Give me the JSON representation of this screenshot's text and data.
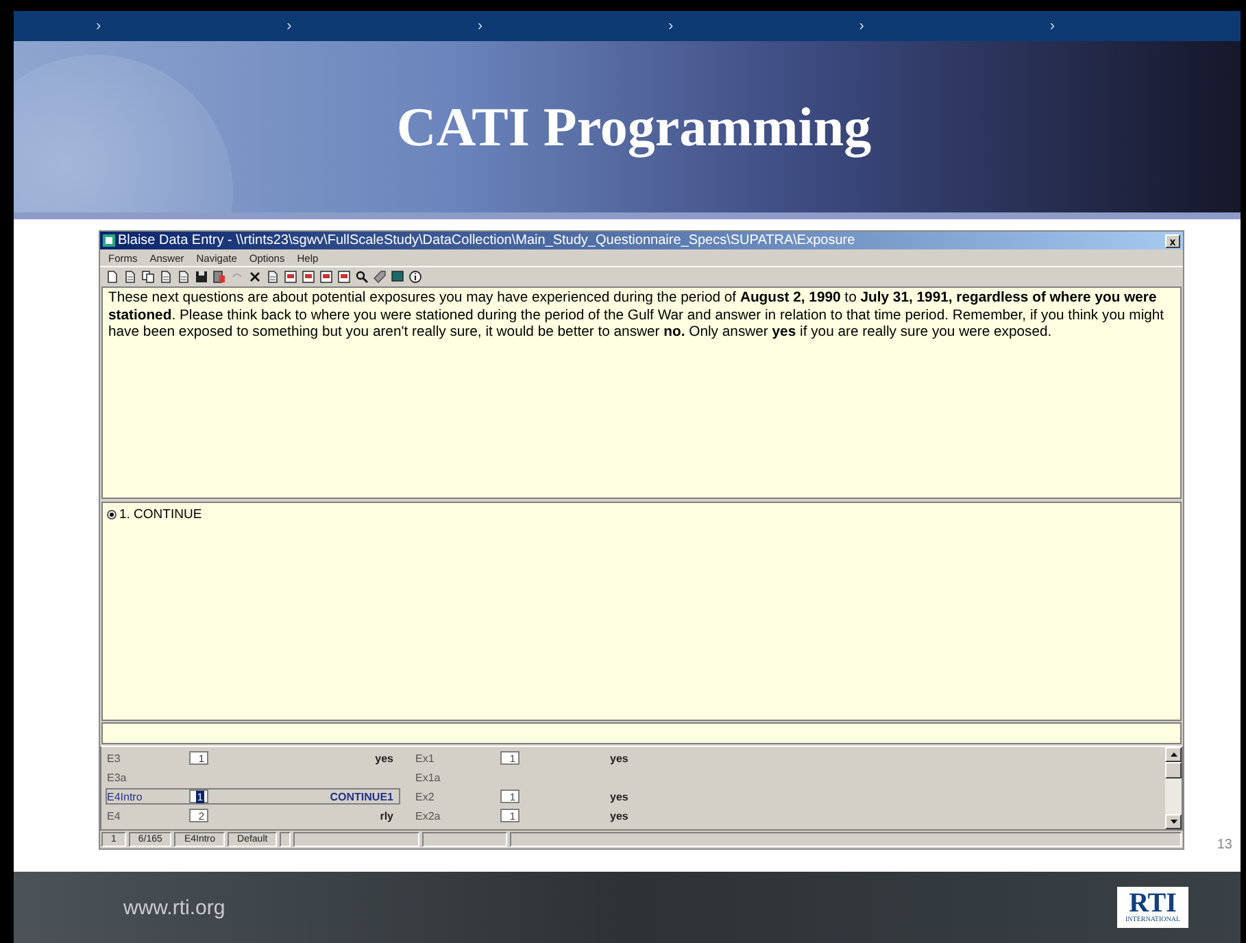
{
  "slide": {
    "nav_marks": [
      "›",
      "›",
      "›",
      "›",
      "›",
      "›"
    ],
    "title": "CATI Programming",
    "page_number": "13",
    "footer_url": "www.rti.org",
    "logo": {
      "text": "RTI",
      "subtitle": "INTERNATIONAL"
    }
  },
  "window": {
    "title": "Blaise Data Entry - \\\\rtints23\\sgwv\\FullScaleStudy\\DataCollection\\Main_Study_Questionnaire_Specs\\SUPATRA\\Exposure",
    "close": "x",
    "menu": [
      "Forms",
      "Answer",
      "Navigate",
      "Options",
      "Help"
    ],
    "question": "These next questions are about potential exposures you may have experienced during the period of **August 2, 1990** to **July 31, 1991, regardless of where you were stationed**. Please think back to where you were stationed during the period of the Gulf War and answer in relation to that time period. Remember, if you think you might have been exposed to something but you aren't really sure, it would be better to answer **no.** Only answer **yes** if you are really sure you were exposed.",
    "answers": [
      {
        "label": "1. CONTINUE",
        "selected": true
      }
    ],
    "grid": [
      {
        "left": {
          "name": "E3",
          "value": "1",
          "answer": "yes",
          "current": false
        },
        "right": {
          "name": "Ex1",
          "value": "1",
          "answer": "yes"
        }
      },
      {
        "left": {
          "name": "E3a",
          "current": false
        },
        "right": {
          "name": "Ex1a"
        }
      },
      {
        "left": {
          "name": "E4Intro",
          "value": "1",
          "answer": "CONTINUE1",
          "current": true
        },
        "right": {
          "name": "Ex2",
          "value": "1",
          "answer": "yes"
        }
      },
      {
        "left": {
          "name": "E4",
          "value": "2",
          "answer": "rly",
          "current": false
        },
        "right": {
          "name": "Ex2a",
          "value": "1",
          "answer": "yes"
        }
      }
    ],
    "status_bar": [
      "1",
      "6/165",
      "E4Intro",
      "Default"
    ]
  }
}
